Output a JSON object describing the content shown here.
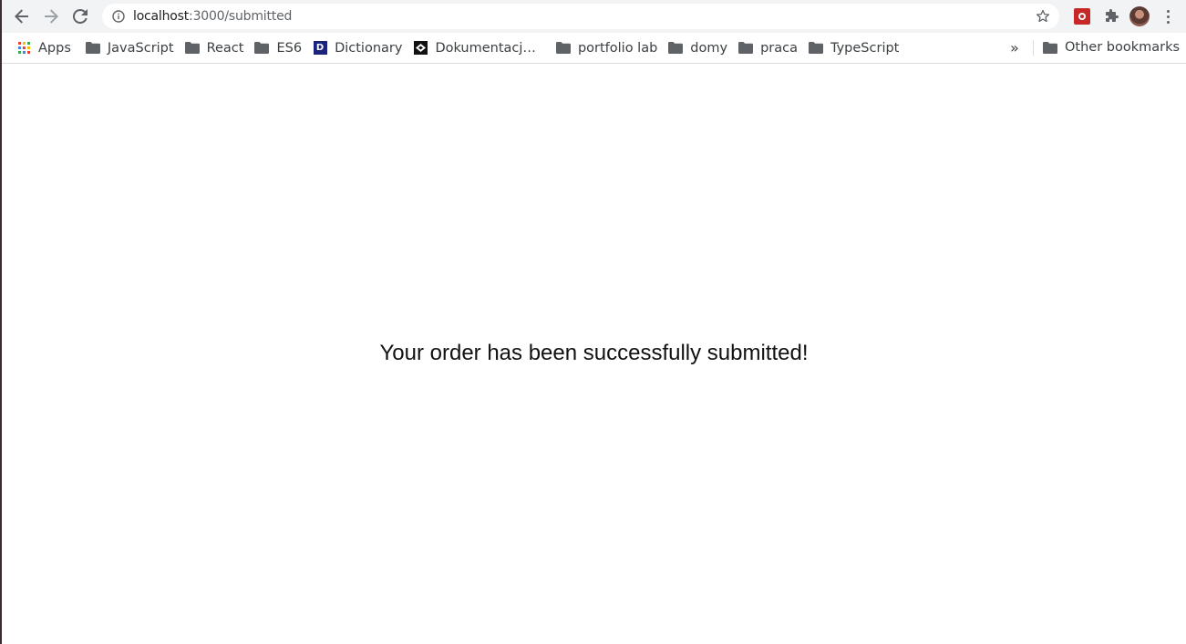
{
  "browser": {
    "url_host": "localhost",
    "url_path": ":3000/submitted"
  },
  "bookmarks": {
    "items": [
      {
        "label": "Apps",
        "icon": "apps-grid-icon"
      },
      {
        "label": "JavaScript",
        "icon": "folder-icon"
      },
      {
        "label": "React",
        "icon": "folder-icon"
      },
      {
        "label": "ES6",
        "icon": "folder-icon"
      },
      {
        "label": "Dictionary",
        "icon": "dictionary-icon"
      },
      {
        "label": "Dokumentacj…",
        "icon": "document-icon"
      },
      {
        "label": "portfolio lab",
        "icon": "folder-icon"
      },
      {
        "label": "domy",
        "icon": "folder-icon"
      },
      {
        "label": "praca",
        "icon": "folder-icon"
      },
      {
        "label": "TypeScript",
        "icon": "folder-icon"
      }
    ],
    "overflow": "»",
    "other_label": "Other bookmarks"
  },
  "page": {
    "message": "Your order has been successfully submitted!"
  },
  "colors": {
    "toolbar_bg": "#f1f3f4",
    "icon_gray": "#5f6368",
    "folder_gray": "#5f6368",
    "text": "#111111"
  }
}
